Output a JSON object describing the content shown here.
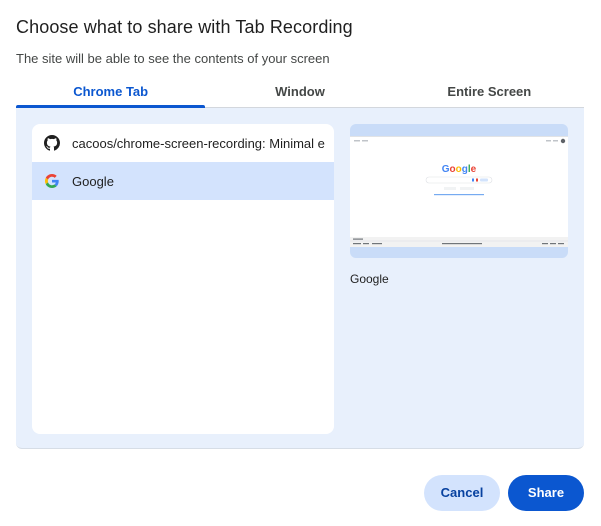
{
  "dialog": {
    "title": "Choose what to share with Tab Recording",
    "subtitle": "The site will be able to see the contents of your screen"
  },
  "tabs": [
    {
      "label": "Chrome Tab",
      "active": true
    },
    {
      "label": "Window",
      "active": false
    },
    {
      "label": "Entire Screen",
      "active": false
    }
  ],
  "tab_list": [
    {
      "icon": "github-icon",
      "label": "cacoos/chrome-screen-recording: Minimal e",
      "selected": false
    },
    {
      "icon": "google-icon",
      "label": "Google",
      "selected": true
    }
  ],
  "preview": {
    "label": "Google",
    "page_logo": "Google"
  },
  "buttons": {
    "cancel": "Cancel",
    "share": "Share"
  },
  "colors": {
    "accent": "#0b57d0",
    "selected_row": "#d3e3fd",
    "panel_bg": "#e8f0fc"
  }
}
